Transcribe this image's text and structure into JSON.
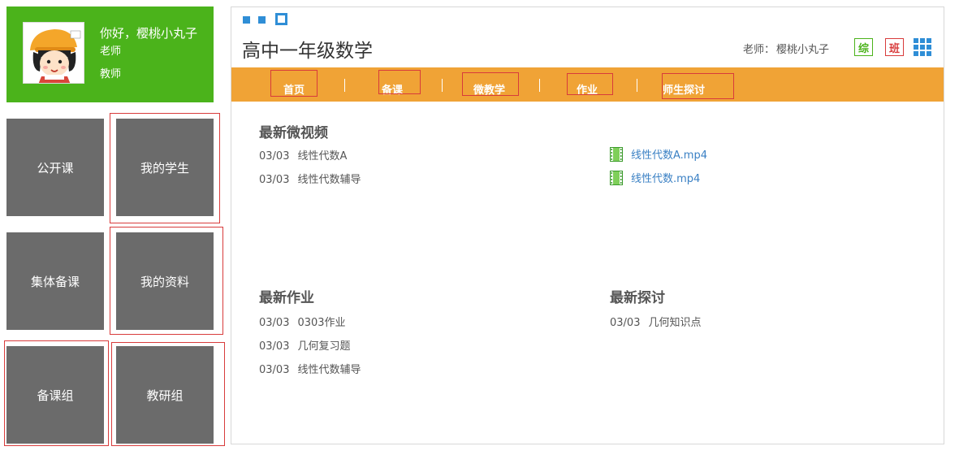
{
  "user": {
    "greeting": "你好，樱桃小丸子",
    "role": "老师",
    "title": "教师"
  },
  "tiles": {
    "public_course": "公开课",
    "my_students": "我的学生",
    "group_prep": "集体备课",
    "my_materials": "我的资料",
    "prep_group": "备课组",
    "research_group": "教研组"
  },
  "header": {
    "course_title": "高中一年级数学",
    "teacher_label": "老师：",
    "teacher_name": "樱桃小丸子",
    "badge_comprehensive": "综",
    "badge_class": "班"
  },
  "nav": {
    "items": [
      {
        "label": "首页"
      },
      {
        "label": "备课"
      },
      {
        "label": "微教学"
      },
      {
        "label": "作业"
      },
      {
        "label": "师生探讨"
      }
    ],
    "separator": "|"
  },
  "sections": {
    "videos": {
      "title": "最新微视频",
      "items": [
        {
          "date": "03/03",
          "name": "线性代数A"
        },
        {
          "date": "03/03",
          "name": "线性代数辅导"
        }
      ],
      "files": [
        {
          "name": "线性代数A.mp4"
        },
        {
          "name": "线性代数.mp4"
        }
      ]
    },
    "homework": {
      "title": "最新作业",
      "items": [
        {
          "date": "03/03",
          "name": "0303作业"
        },
        {
          "date": "03/03",
          "name": "几何复习题"
        },
        {
          "date": "03/03",
          "name": "线性代数辅导"
        }
      ]
    },
    "discussion": {
      "title": "最新探讨",
      "items": [
        {
          "date": "03/03",
          "name": "几何知识点"
        }
      ]
    }
  },
  "colors": {
    "user_card": "#4bb31b",
    "tile": "#6b6b6b",
    "nav_bar": "#f0a336",
    "accent_blue": "#2f8ed6",
    "annotation_red": "#d83b3b",
    "link": "#3a80c4"
  },
  "icons": {
    "window_controls": "window-dots-icon",
    "grid": "grid-icon",
    "video_file": "film-icon"
  }
}
